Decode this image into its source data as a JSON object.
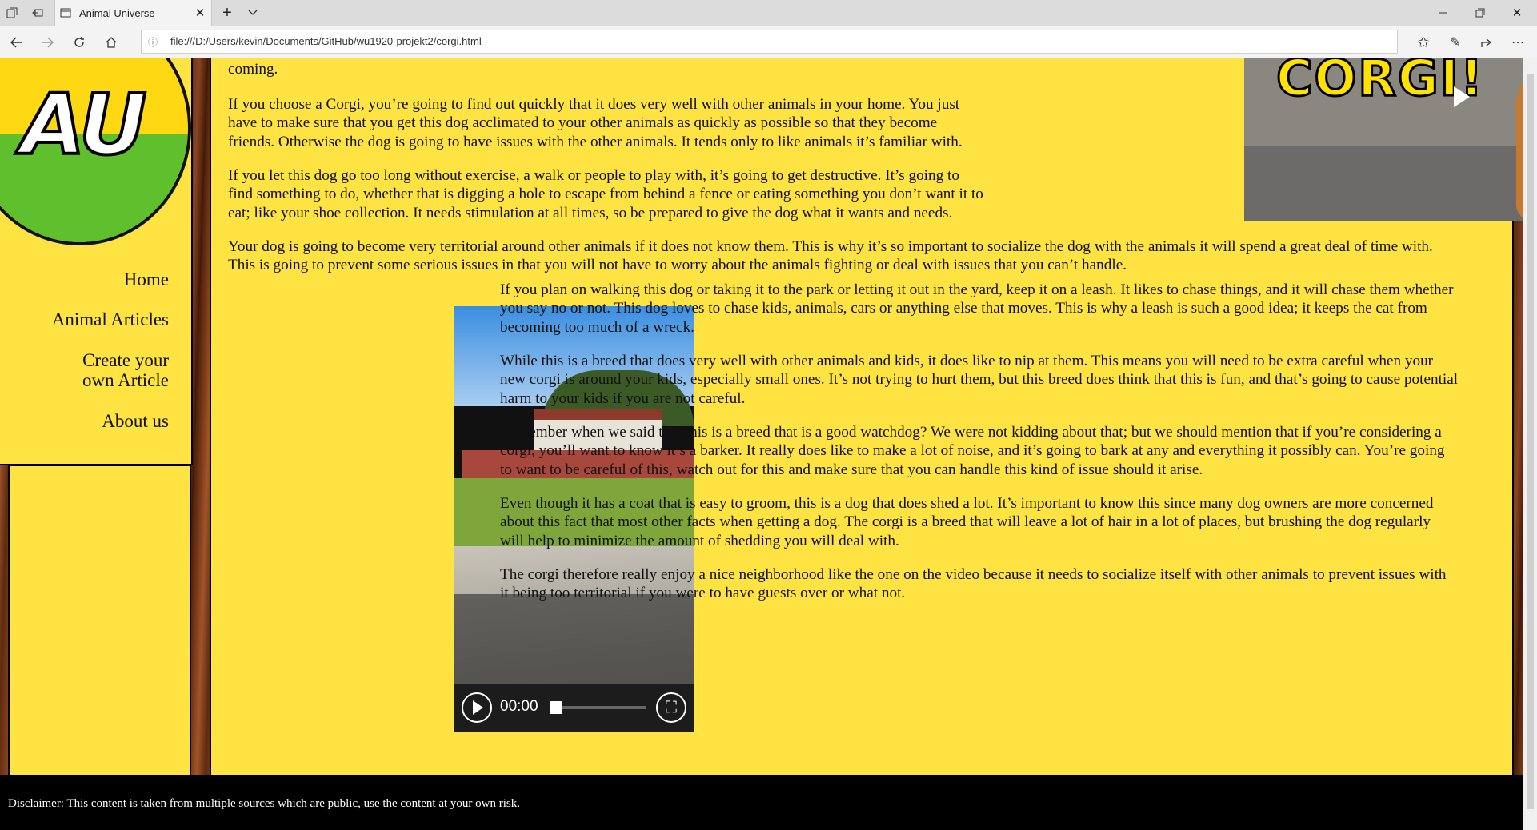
{
  "browser": {
    "tab_title": "Animal Universe",
    "url": "file:///D:/Users/kevin/Documents/GitHub/wu1920-projekt2/corgi.html"
  },
  "logo": {
    "text": "AU"
  },
  "nav": {
    "items": [
      {
        "label": "Home"
      },
      {
        "label": "Animal Articles"
      },
      {
        "label_line1": "Create your",
        "label_line2": "own Article"
      },
      {
        "label": "About us"
      }
    ]
  },
  "video_corgi": {
    "title_text": "CORGI!"
  },
  "video_yard": {
    "time": "00:00",
    "progress": 0
  },
  "article": {
    "p0_tail": "coming.",
    "p1": [
      "If you choose a Corgi, you’re going to find out quickly that it does very well with other animals in your home. You just",
      "have to make sure that you get this dog acclimated to your other animals as quickly as possible so that they become",
      "friends. Otherwise the dog is going to have issues with the other animals. It tends only to like animals it’s familiar with."
    ],
    "p2": [
      "If you let this dog go too long without exercise, a walk or people to play with, it’s going to get destructive. It’s going to",
      "find something to do, whether that is digging a hole to escape from behind a fence or eating something you don’t want it to",
      "eat; like your shoe collection. It needs stimulation at all times, so be prepared to give the dog what it wants and needs."
    ],
    "p3": [
      "Your dog is going to become very territorial around other animals if it does not know them. This is why it’s so important to socialize the dog with the animals it will spend a great deal of time with.",
      "This is going to prevent some serious issues in that you will not have to worry about the animals fighting or deal with issues that you can’t handle."
    ],
    "p4": [
      "If you plan on walking this dog or taking it to the park or letting it out in the yard, keep it on a leash. It likes to chase things, and it will chase them whether",
      "you say no or not. This dog loves to chase kids, animals, cars or anything else that moves. This is why a leash is such a good idea; it keeps the cat from",
      "becoming too much of a wreck."
    ],
    "p5": [
      "While this is a breed that does very well with other animals and kids, it does like to nip at them. This means you will need to be extra careful when your",
      "new corgi is around your kids, especially small ones. It’s not trying to hurt them, but this breed does think that this is fun, and that’s going to cause potential",
      "harm to your kids if you are not careful."
    ],
    "p6": [
      "Remember when we said that this is a breed that is a good watchdog? We were not kidding about that; but we should mention that if you’re considering a",
      "corgi, you’ll want to know it’s a barker. It really does like to make a lot of noise, and it’s going to bark at any and everything it possibly can. You’re going",
      "to want to be careful of this, watch out for this and make sure that you can handle this kind of issue should it arise."
    ],
    "p7": [
      "Even though it has a coat that is easy to groom, this is a dog that does shed a lot. It’s important to know this since many dog owners are more concerned",
      "about this fact that most other facts when getting a dog. The corgi is a breed that will leave a lot of hair in a lot of places, but brushing the dog regularly",
      "will help to minimize the amount of shedding you will deal with."
    ],
    "p8": [
      "The corgi therefore really enjoy a nice neighborhood like the one on the video because it needs to socialize itself with other animals to prevent issues with",
      "it being too territorial if you were to have guests over or what not."
    ]
  },
  "footer": {
    "disclaimer": "Disclaimer: This content is taken from multiple sources which are public, use the content at your own risk."
  }
}
